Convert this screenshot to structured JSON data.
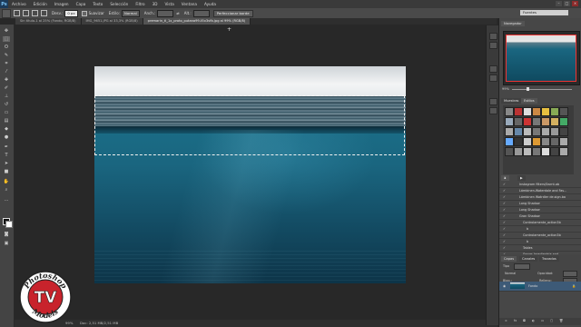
{
  "menubar": {
    "app_icon": "Ps",
    "items": [
      "Archivo",
      "Edición",
      "Imagen",
      "Capa",
      "Texto",
      "Selección",
      "Filtro",
      "3D",
      "Vista",
      "Ventana",
      "Ayuda"
    ],
    "window_controls": [
      "minimize-icon",
      "restore-icon",
      "close-icon"
    ]
  },
  "options": {
    "feather_label": "Desv.:",
    "feather_value": "0 px",
    "smooth_label": "Suavizar",
    "style_label": "Estilo:",
    "style_value": "Normal",
    "width_label": "Anch.:",
    "height_label": "Alt.:",
    "refine_button": "Perfeccionar borde",
    "workspace_value": "Fuentes"
  },
  "tabs": [
    {
      "label": "Sin título-1 al 25% (Fondo, RGB/8)"
    },
    {
      "label": "IMG_9651.JPG al 33,3% (RGB/8)"
    },
    {
      "label": "premarin_tl_1x_proto_putana99-t5x3vfb.jpg al 99% (RGB/8)",
      "active": true
    }
  ],
  "status": {
    "zoom": "99%",
    "doc": "Doc: 2,51 MB/2,51 MB"
  },
  "panels": {
    "navigator_tab": "Navegador",
    "navigator_zoom": "99%",
    "swatches_tab": "Muestras",
    "styles_tab": "Estilos",
    "layers_tab": "Capas",
    "channels_tab": "Canales",
    "paths_tab": "Trazados",
    "kind_label": "Tipo",
    "blend_mode": "Normal",
    "opacity_label": "Opacidad:",
    "lock_label": "Bloq.:",
    "fill_label": "Relleno:"
  },
  "layers": [
    {
      "name": "Instagram filters/Swrnt.ab",
      "indent": 2
    },
    {
      "name": "Lámbinen-Waterdale and Fas...",
      "indent": 2
    },
    {
      "name": "Lámbinen Watrdler de.sign.ba",
      "indent": 2
    },
    {
      "name": "Long Shadow",
      "indent": 2
    },
    {
      "name": "Long Shadow",
      "indent": 2
    },
    {
      "name": "Gran Shadow",
      "indent": 2
    },
    {
      "name": "Controlamente_action3b",
      "indent": 3
    },
    {
      "name": "b",
      "indent": 4
    },
    {
      "name": "Controlamente_action3b",
      "indent": 3
    },
    {
      "name": "b",
      "indent": 4
    },
    {
      "name": "Tables",
      "indent": 3
    },
    {
      "name": "Sorras Inradiantria and",
      "indent": 3
    }
  ],
  "background_layer": {
    "name": "Fondo"
  },
  "logo": {
    "top_text": "Photoshop",
    "middle_text": "TV",
    "bottom_text": "Models"
  },
  "colors": {
    "accent": "#3d5a77",
    "selection": "#f2f2f2",
    "logo_red": "#c8232c"
  }
}
